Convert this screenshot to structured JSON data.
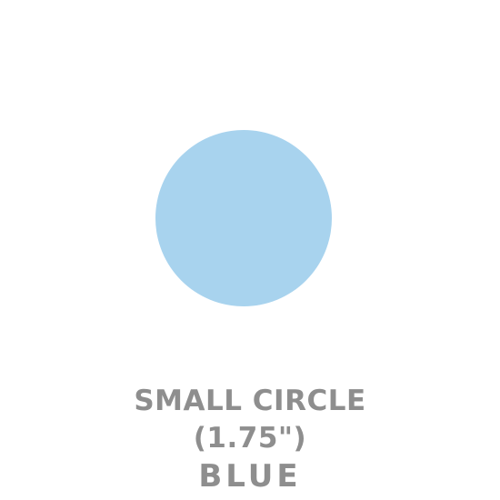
{
  "swatch": {
    "color": "#a8d3ee"
  },
  "caption": {
    "name": "SMALL CIRCLE",
    "size": "(1.75\")",
    "color_name": "BLUE"
  },
  "theme": {
    "text_color": "#8e8e8e",
    "background": "#ffffff"
  }
}
